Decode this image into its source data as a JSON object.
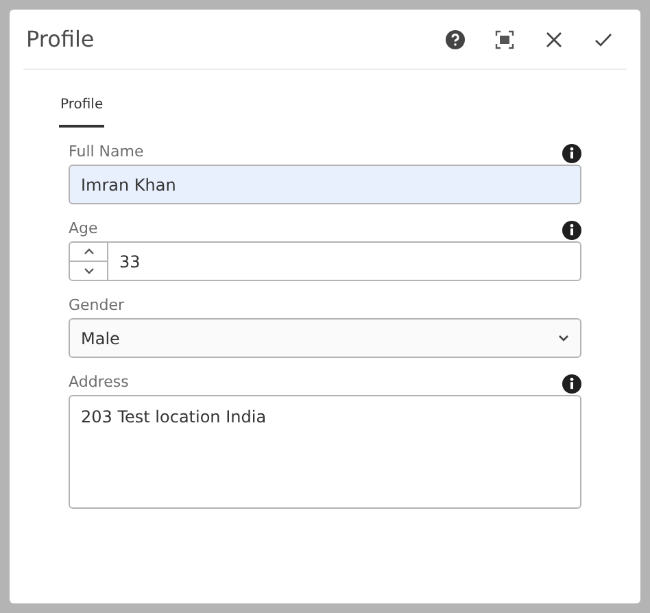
{
  "dialog": {
    "title": "Profile"
  },
  "tabs": [
    {
      "label": "Profile",
      "selected": true
    }
  ],
  "fields": [
    {
      "kind": "text",
      "label": "Full Name",
      "value": "Imran Khan",
      "info": true,
      "autofilled": true
    },
    {
      "kind": "number",
      "label": "Age",
      "value": "33",
      "info": true,
      "autofilled": false
    },
    {
      "kind": "select",
      "label": "Gender",
      "value": "Male",
      "info": false,
      "autofilled": false
    },
    {
      "kind": "textarea",
      "label": "Address",
      "value": "203 Test location India",
      "info": true,
      "autofilled": false
    }
  ]
}
